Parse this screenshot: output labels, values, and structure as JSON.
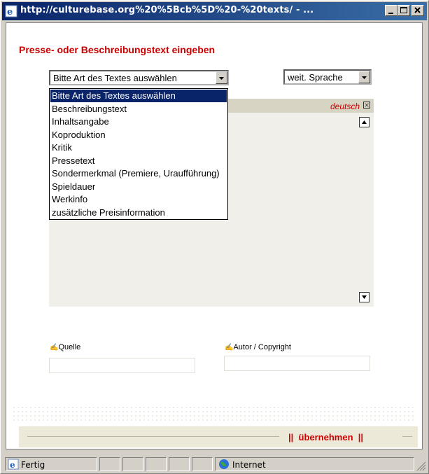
{
  "window": {
    "title": "http://culturebase.org%20%5Bcb%5D%20-%20texts/ - ..."
  },
  "form": {
    "heading": "Presse- oder Beschreibungstext eingeben",
    "text_type_select": {
      "value": "Bitte Art des Textes auswählen",
      "options": [
        "Bitte Art des Textes auswählen",
        "Beschreibungstext",
        "Inhaltsangabe",
        "Koproduktion",
        "Kritik",
        "Pressetext",
        "Sondermerkmal (Premiere, Uraufführung)",
        "Spieldauer",
        "Werkinfo",
        "zusätzliche Preisinformation"
      ],
      "highlighted_index": 0
    },
    "language_select": {
      "value": "weit. Sprache"
    },
    "editor": {
      "language_label": "deutsch"
    },
    "source_label": "Quelle",
    "author_label": "Autor / Copyright",
    "submit_label": "übernehmen",
    "submit_separator": "||"
  },
  "statusbar": {
    "status_text": "Fertig",
    "zone_text": "Internet"
  },
  "colors": {
    "accent_red": "#cc0000",
    "titlebar_start": "#0a246a",
    "titlebar_end": "#3a6ea5",
    "selection": "#0a246a"
  },
  "icons": [
    "ie-page-icon",
    "minimize-icon",
    "maximize-icon",
    "close-icon",
    "scroll-up-icon",
    "scroll-down-icon",
    "close-box-icon",
    "ie-status-icon",
    "globe-icon",
    "resize-grip-icon"
  ]
}
